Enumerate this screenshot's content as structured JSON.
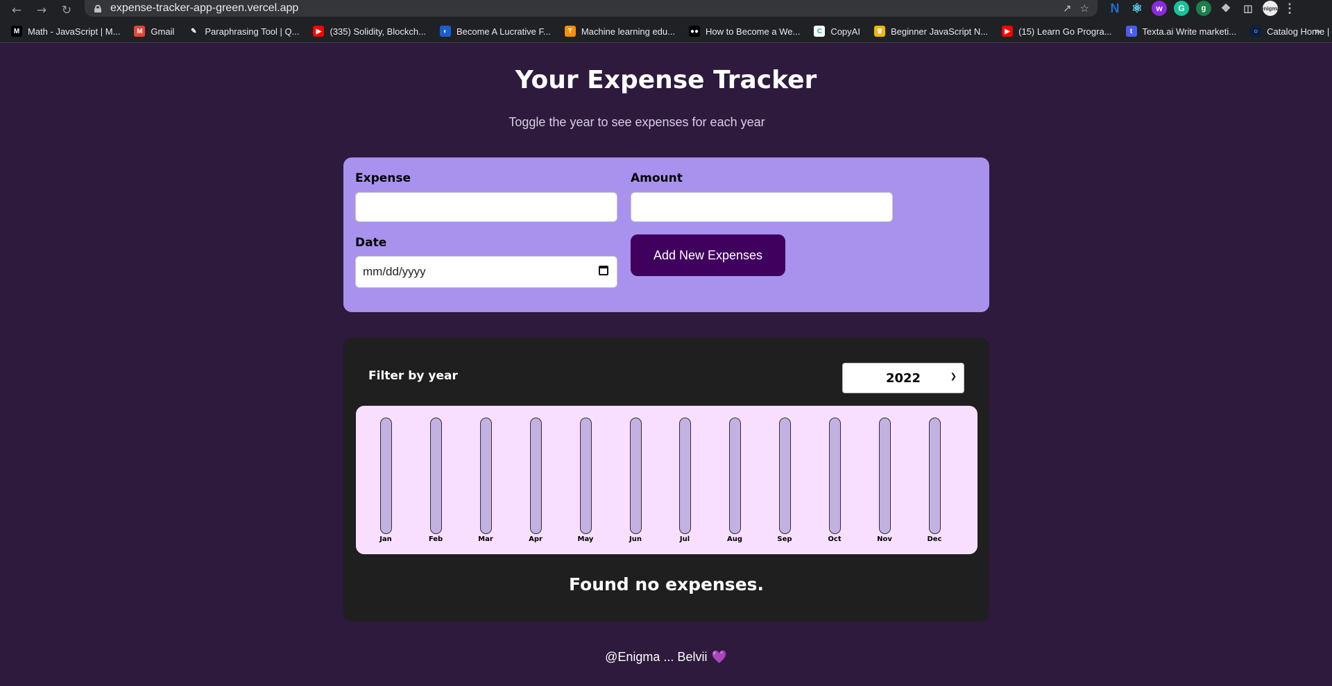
{
  "browser": {
    "url": "expense-tracker-app-green.vercel.app",
    "bookmarks": [
      {
        "label": "Math - JavaScript | M...",
        "icon": "M",
        "color": "#000000"
      },
      {
        "label": "Gmail",
        "icon": "M",
        "color": "#ea4335"
      },
      {
        "label": "Paraphrasing Tool | Q...",
        "icon": "✎",
        "color": "#202124"
      },
      {
        "label": "(335) Solidity, Blockch...",
        "icon": "▶",
        "color": "#ff0000"
      },
      {
        "label": "Become A Lucrative F...",
        "icon": "◐",
        "color": "#1a5fd1"
      },
      {
        "label": "Machine learning edu...",
        "icon": "T",
        "color": "#ff8f00"
      },
      {
        "label": "How to Become a We...",
        "icon": "●●",
        "color": "#000000"
      },
      {
        "label": "CopyAI",
        "icon": "C",
        "color": "#ffffff"
      },
      {
        "label": "Beginner JavaScript N...",
        "icon": "♛",
        "color": "#f4b400"
      },
      {
        "label": "(15) Learn Go Progra...",
        "icon": "▶",
        "color": "#ff0000"
      },
      {
        "label": "Texta.ai Write marketi...",
        "icon": "t",
        "color": "#4b5cf0"
      },
      {
        "label": "Catalog Home | Code...",
        "icon": "○",
        "color": "#0a1f44"
      }
    ]
  },
  "header": {
    "title": "Your Expense Tracker",
    "subtitle": "Toggle the year to see expenses for each year"
  },
  "form": {
    "expense_label": "Expense",
    "amount_label": "Amount",
    "date_label": "Date",
    "expense_value": "",
    "amount_value": "",
    "date_placeholder": "mm/dd/yyyy",
    "submit_label": "Add New Expenses"
  },
  "filter": {
    "label": "Filter by year",
    "selected_year": "2022"
  },
  "chart_data": {
    "type": "bar",
    "categories": [
      "Jan",
      "Feb",
      "Mar",
      "Apr",
      "May",
      "Jun",
      "Jul",
      "Aug",
      "Sep",
      "Oct",
      "Nov",
      "Dec"
    ],
    "values": [
      0,
      0,
      0,
      0,
      0,
      0,
      0,
      0,
      0,
      0,
      0,
      0
    ],
    "ylim": [
      0,
      1
    ]
  },
  "empty_message": "Found no expenses.",
  "footer": {
    "text": "@Enigma ... Belvii",
    "heart": "💜"
  },
  "colors": {
    "page_bg": "#2d1a3d",
    "form_card": "#a892ee",
    "button": "#40005d",
    "chart_bg": "#f8dfff",
    "bar_track": "#c3b1e1"
  }
}
